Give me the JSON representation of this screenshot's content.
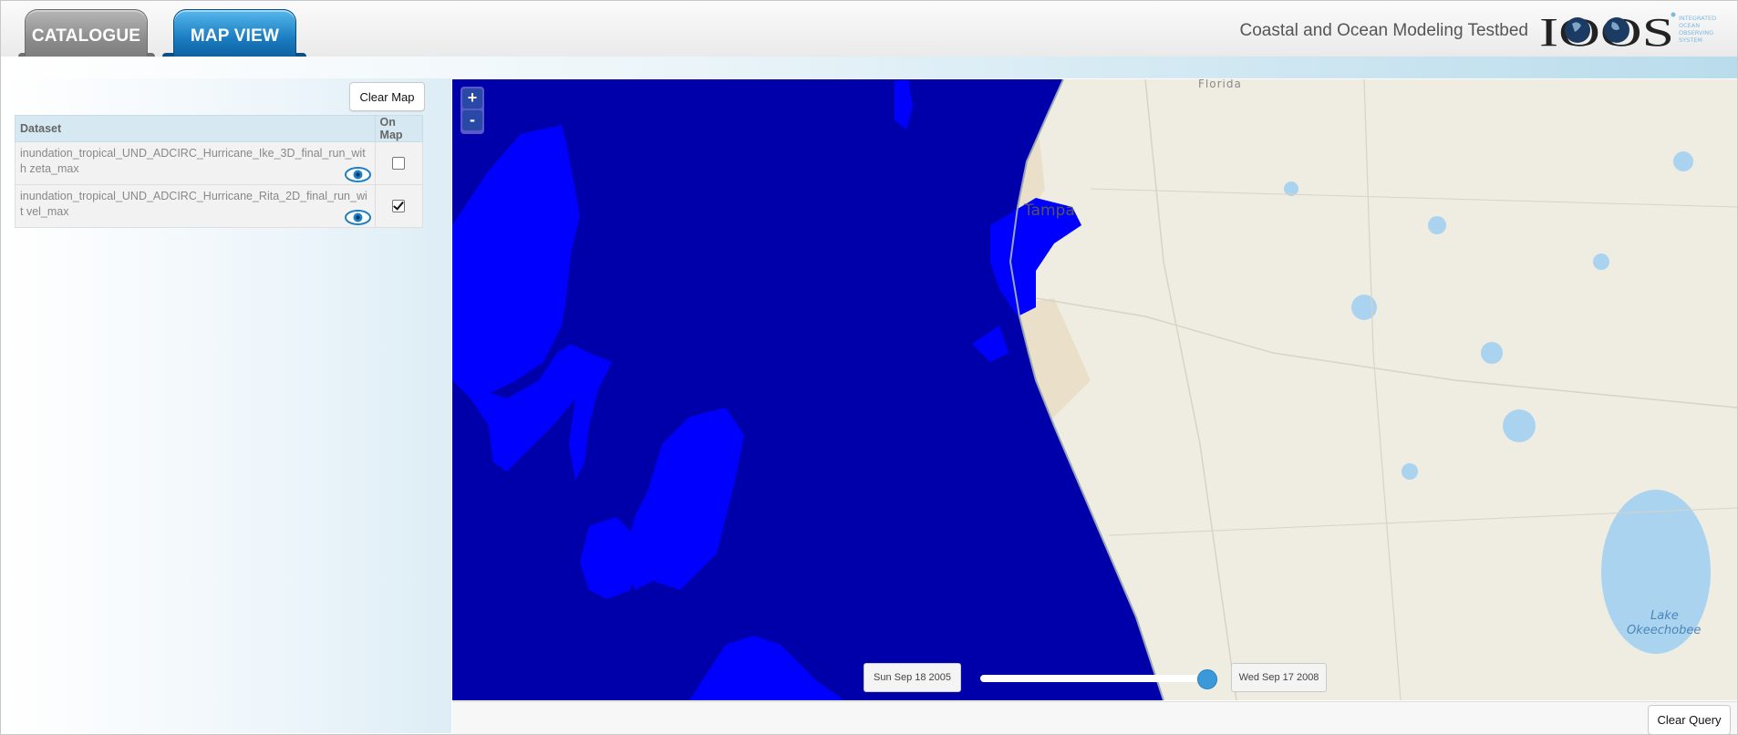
{
  "header": {
    "tabs": [
      {
        "label": "CATALOGUE",
        "active": false
      },
      {
        "label": "MAP VIEW",
        "active": true
      }
    ],
    "site_title": "Coastal and Ocean Modeling Testbed",
    "logo": {
      "text": "IOOS",
      "tagline": [
        "INTEGRATED",
        "OCEAN",
        "OBSERVING",
        "SYSTEM"
      ]
    }
  },
  "sidebar": {
    "clear_map_label": "Clear Map",
    "table": {
      "columns": [
        "Dataset",
        "On Map"
      ],
      "rows": [
        {
          "name": "inundation_tropical_UND_ADCIRC_Hurricane_Ike_3D_final_run_with zeta_max",
          "on_map": false
        },
        {
          "name": "inundation_tropical_UND_ADCIRC_Hurricane_Rita_2D_final_run_wit vel_max",
          "on_map": true
        }
      ]
    }
  },
  "map": {
    "zoom_in": "+",
    "zoom_out": "-",
    "labels": {
      "region": "Florida",
      "city": "Tampa",
      "lake_line1": "Lake",
      "lake_line2": "Okeechobee"
    },
    "colors": {
      "water_dark": "#0000aa",
      "water_bright": "#0000ff",
      "land": "#efece2",
      "lake": "#aad3f0"
    }
  },
  "timeline": {
    "start_label": "Sun Sep 18 2005",
    "end_label": "Wed Sep 17 2008",
    "position": 1.0
  },
  "footer": {
    "clear_query_label": "Clear Query"
  }
}
